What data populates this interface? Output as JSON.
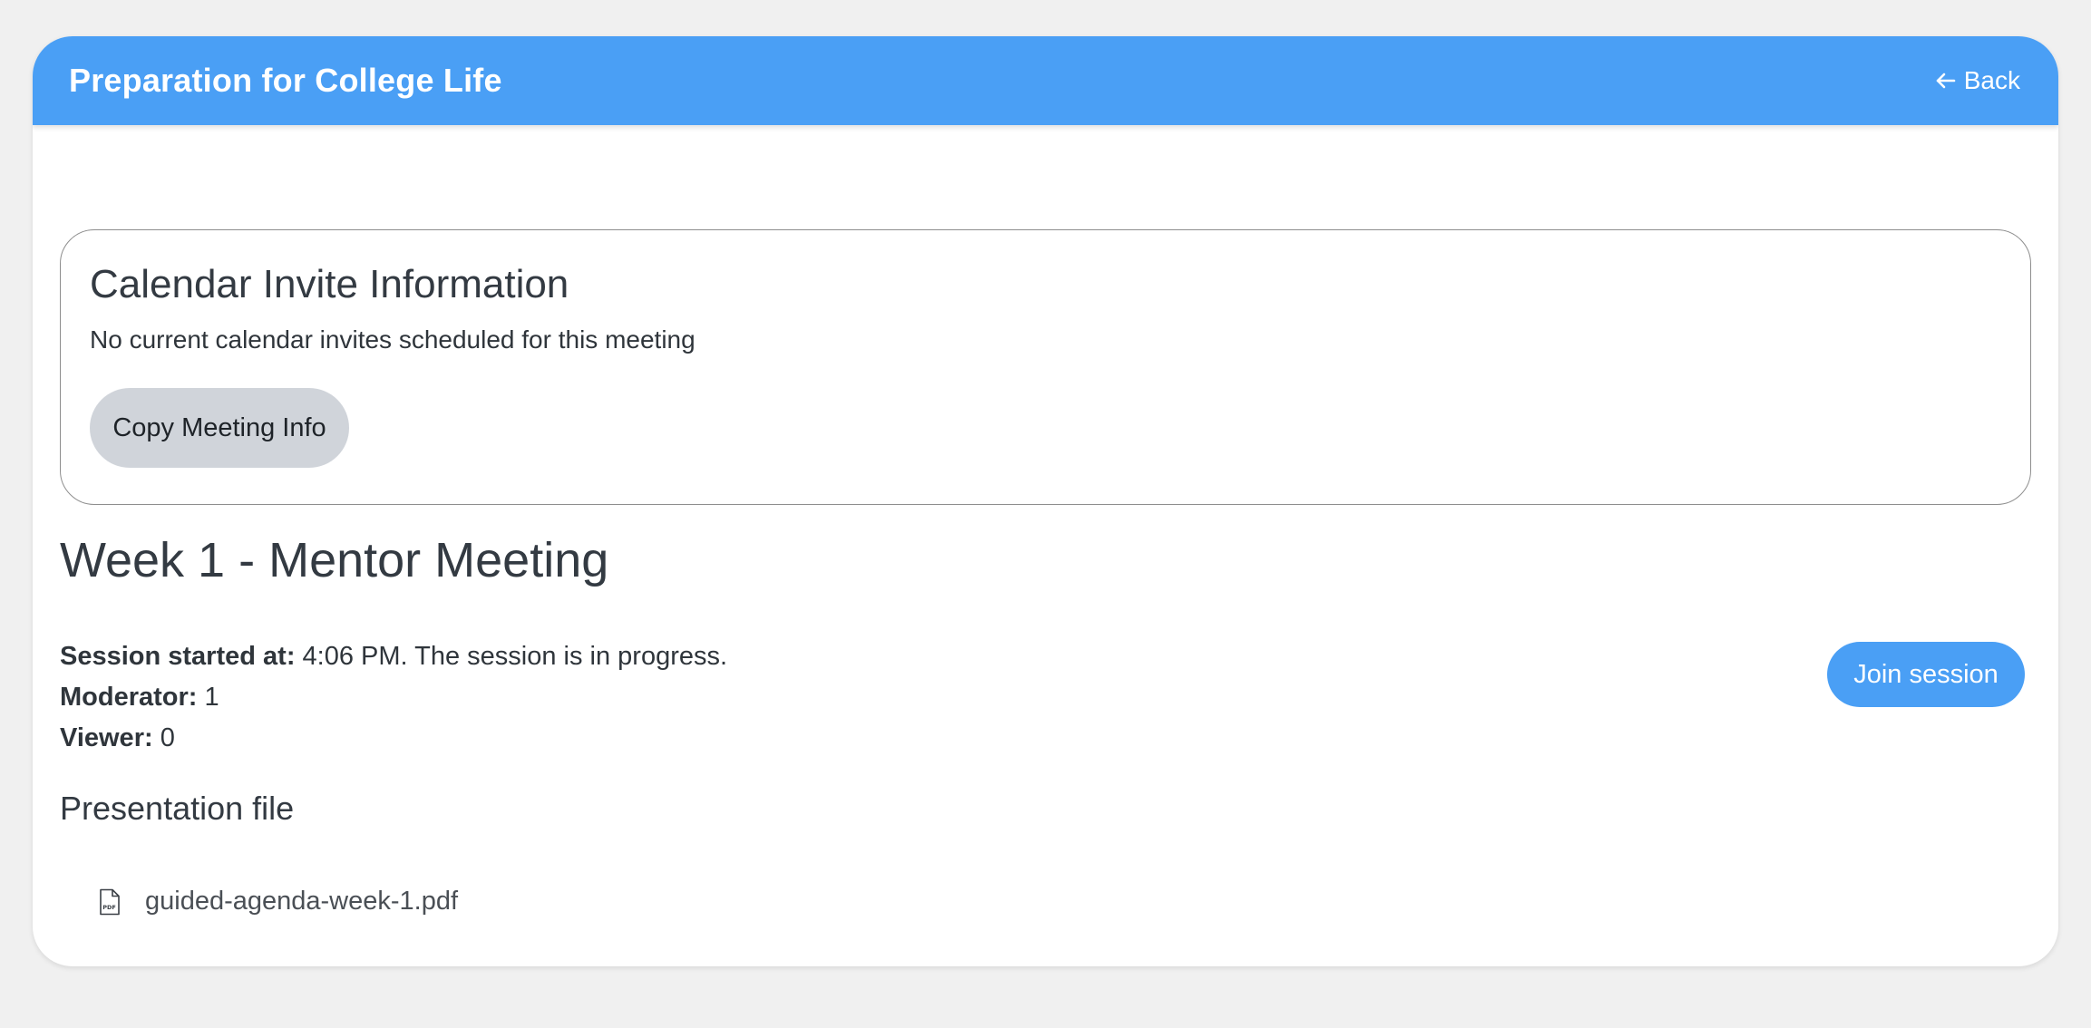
{
  "header": {
    "title": "Preparation for College Life",
    "back_label": "Back"
  },
  "calendar_invite": {
    "title": "Calendar Invite Information",
    "message": "No current calendar invites scheduled for this meeting",
    "copy_button_label": "Copy Meeting Info"
  },
  "meeting": {
    "title": "Week 1 - Mentor Meeting",
    "session_started_label": "Session started at:",
    "session_started_value": "4:06 PM. The session is in progress.",
    "moderator_label": "Moderator:",
    "moderator_value": "1",
    "viewer_label": "Viewer:",
    "viewer_value": "0",
    "join_button_label": "Join session"
  },
  "presentation": {
    "heading": "Presentation file",
    "files": [
      {
        "name": "guided-agenda-week-1.pdf",
        "icon": "pdf-file-icon"
      }
    ]
  },
  "colors": {
    "accent": "#4a9ff5",
    "background": "#f0f0f0",
    "secondary_button": "#d0d4da"
  },
  "icons": {
    "back": "arrow-left-icon",
    "file": "pdf-file-icon"
  }
}
